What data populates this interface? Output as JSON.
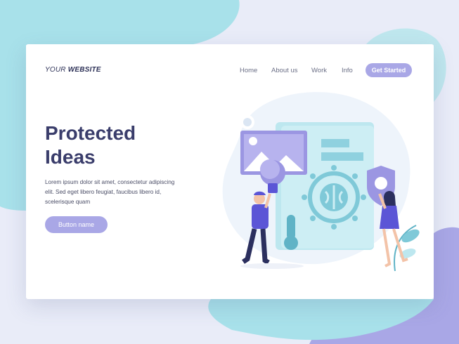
{
  "header": {
    "logo_prefix": "YOUR",
    "logo_suffix": "WEBSITE"
  },
  "nav": {
    "items": [
      "Home",
      "About us",
      "Work",
      "Info"
    ],
    "cta_label": "Get Started"
  },
  "hero": {
    "title_line1": "Protected",
    "title_line2": "Ideas",
    "body_line1": "Lorem ipsum dolor sit amet, consectetur adipiscing",
    "body_line2": "elit. Sed eget libero feugiat, faucibus libero id,",
    "body_line3": "scelerisque quam",
    "button_label": "Button name"
  },
  "colors": {
    "background": "#e9ecf8",
    "blob_teal": "#a8e1ea",
    "blob_purple": "#a9a7e6",
    "accent": "#a9a7e6",
    "title": "#3a3d6b",
    "illustration_teal": "#bde7ef",
    "illustration_purple": "#9b96e2",
    "figure_blue": "#5b55d6",
    "figure_navy": "#2b2f5e"
  },
  "icons": [
    "image-icon",
    "lightbulb-icon",
    "brain-gear-icon",
    "lock-icon",
    "shield-icon",
    "thermometer-icon",
    "plant-icon"
  ]
}
